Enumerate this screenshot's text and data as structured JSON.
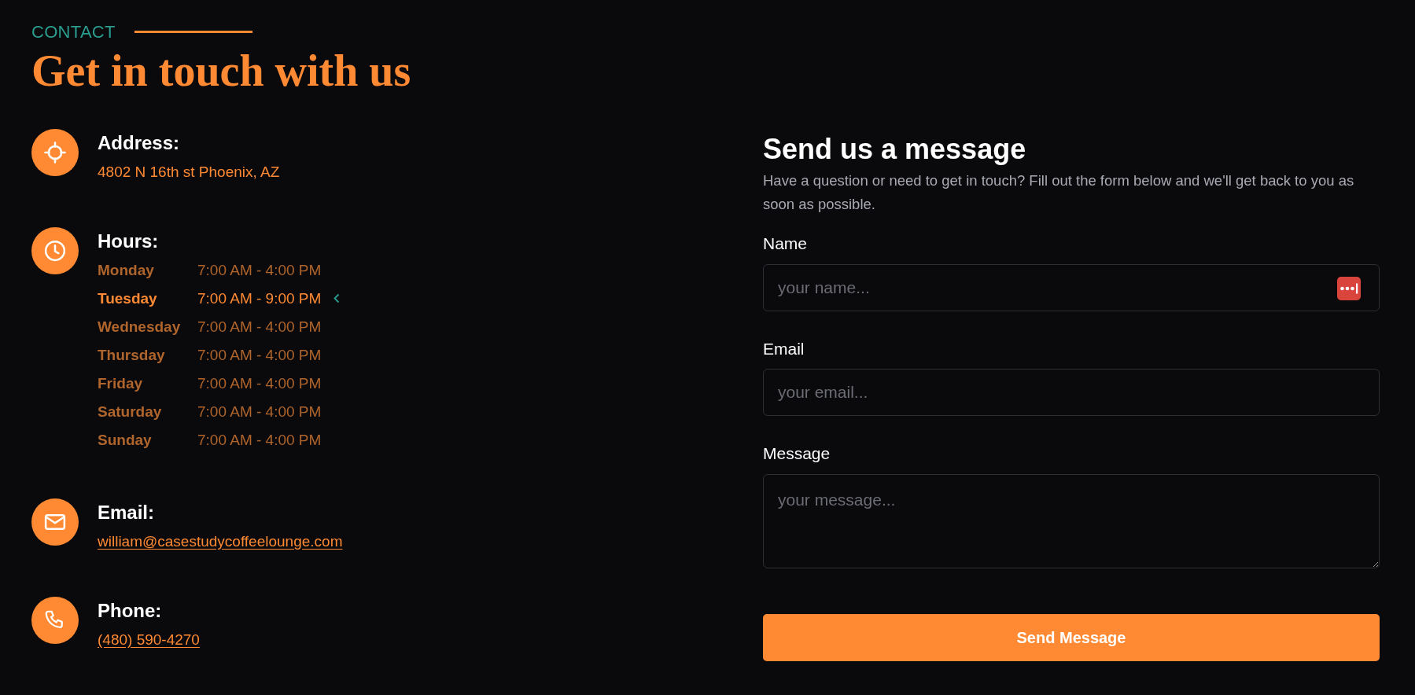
{
  "section_label": "CONTACT",
  "heading": "Get in touch with us",
  "contact_items": [
    {
      "kind": "address",
      "title": "Address:",
      "value": "4802 N 16th st Phoenix, AZ"
    },
    {
      "kind": "hours",
      "title": "Hours:",
      "hours": [
        {
          "day": "Monday",
          "time": "7:00 AM - 4:00 PM",
          "selected": false
        },
        {
          "day": "Tuesday",
          "time": "7:00 AM - 9:00 PM",
          "selected": true
        },
        {
          "day": "Wednesday",
          "time": "7:00 AM - 4:00 PM",
          "selected": false
        },
        {
          "day": "Thursday",
          "time": "7:00 AM - 4:00 PM",
          "selected": false
        },
        {
          "day": "Friday",
          "time": "7:00 AM - 4:00 PM",
          "selected": false
        },
        {
          "day": "Saturday",
          "time": "7:00 AM - 4:00 PM",
          "selected": false
        },
        {
          "day": "Sunday",
          "time": "7:00 AM - 4:00 PM",
          "selected": false
        }
      ]
    },
    {
      "kind": "email",
      "title": "Email:",
      "value": "william@casestudycoffeelounge.com"
    },
    {
      "kind": "phone",
      "title": "Phone:",
      "value": "(480) 590-4270"
    }
  ],
  "form": {
    "title": "Send us a message",
    "description": "Have a question or need to get in touch? Fill out the form below and we'll get back to you as soon as possible.",
    "fields": [
      {
        "kind": "input",
        "label": "Name",
        "placeholder": "your name...",
        "autofill_icon": true
      },
      {
        "kind": "input",
        "label": "Email",
        "placeholder": "your email...",
        "autofill_icon": false
      },
      {
        "kind": "textarea",
        "label": "Message",
        "placeholder": "your message...",
        "autofill_icon": false
      }
    ],
    "submit": "Send Message"
  }
}
